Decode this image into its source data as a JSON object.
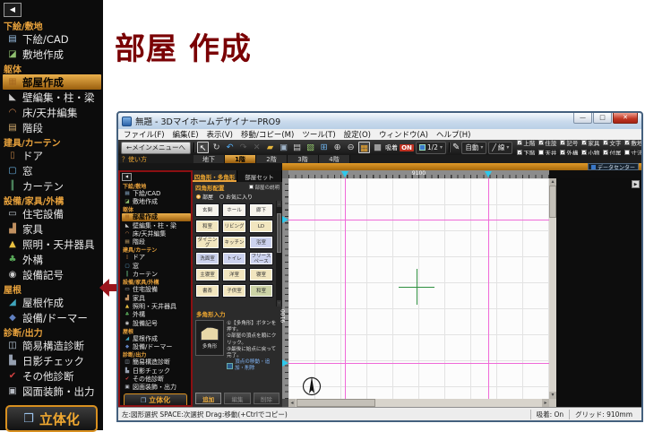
{
  "page": {
    "heading": "部屋 作成"
  },
  "sidebar": {
    "collapse_glyph": "◀",
    "items": [
      {
        "t": "section",
        "label": "下絵/敷地"
      },
      {
        "t": "item",
        "label": "下絵/CAD",
        "glyph": "▤",
        "color": "#9cc2e6"
      },
      {
        "t": "item",
        "label": "敷地作成",
        "glyph": "◪",
        "color": "#8fbf6f"
      },
      {
        "t": "section",
        "label": "躯体"
      },
      {
        "t": "item",
        "label": "部屋作成",
        "glyph": "▦",
        "color": "#a86a20",
        "selected": true
      },
      {
        "t": "item",
        "label": "壁編集・柱・梁",
        "glyph": "◣",
        "color": "#c8c8c8"
      },
      {
        "t": "item",
        "label": "床/天井編集",
        "glyph": "◠",
        "color": "#c8824e"
      },
      {
        "t": "item",
        "label": "階段",
        "glyph": "▤",
        "color": "#d8b070"
      },
      {
        "t": "section",
        "label": "建具/カーテン"
      },
      {
        "t": "item",
        "label": "ドア",
        "glyph": "▯",
        "color": "#b07840"
      },
      {
        "t": "item",
        "label": "窓",
        "glyph": "▢",
        "color": "#6cb4e4"
      },
      {
        "t": "item",
        "label": "カーテン",
        "glyph": "║",
        "color": "#6cc084"
      },
      {
        "t": "section",
        "label": "設備/家具/外構"
      },
      {
        "t": "item",
        "label": "住宅設備",
        "glyph": "▭",
        "color": "#c2cad2"
      },
      {
        "t": "item",
        "label": "家具",
        "glyph": "▟",
        "color": "#c09060"
      },
      {
        "t": "item",
        "label": "照明・天井器具",
        "glyph": "▲",
        "color": "#e8c040"
      },
      {
        "t": "item",
        "label": "外構",
        "glyph": "♣",
        "color": "#58a858"
      },
      {
        "t": "item",
        "label": "設備記号",
        "glyph": "◉",
        "color": "#d0d0d0"
      },
      {
        "t": "section",
        "label": "屋根"
      },
      {
        "t": "item",
        "label": "屋根作成",
        "glyph": "◢",
        "color": "#3fa4bc"
      },
      {
        "t": "item",
        "label": "設備/ドーマー",
        "glyph": "◆",
        "color": "#6080c0"
      },
      {
        "t": "section",
        "label": "診断/出力"
      },
      {
        "t": "item",
        "label": "簡易構造診断",
        "glyph": "◫",
        "color": "#c0d0e0"
      },
      {
        "t": "item",
        "label": "日影チェック",
        "glyph": "▙",
        "color": "#96a0b0"
      },
      {
        "t": "item",
        "label": "その他診断",
        "glyph": "✔",
        "color": "#d04040"
      },
      {
        "t": "item",
        "label": "図面装飾・出力",
        "glyph": "▣",
        "color": "#b8bcc4"
      }
    ],
    "solid_button": {
      "label": "立体化",
      "glyph": "❒"
    }
  },
  "win": {
    "title": "無題 - 3DマイホームデザイナーPRO9",
    "controls": {
      "min": "—",
      "max": "□",
      "close": "✕"
    },
    "menus": [
      "ファイル(F)",
      "編集(E)",
      "表示(V)",
      "移動/コピー(M)",
      "ツール(T)",
      "設定(O)",
      "ウィンドウ(A)",
      "ヘルプ(H)"
    ],
    "toolbar": {
      "back": "←メインメニューへ",
      "icons": [
        {
          "name": "select-cursor-icon",
          "glyph": "↖",
          "color": "#ffffff",
          "active": true
        },
        {
          "name": "rotate-select-icon",
          "glyph": "↻",
          "color": "#cfcfcf"
        },
        {
          "name": "undo-icon",
          "glyph": "↶",
          "color": "#54aaf0"
        },
        {
          "name": "redo-icon",
          "glyph": "↷",
          "color": "#5a5a5a"
        },
        {
          "name": "delete-icon",
          "glyph": "✕",
          "color": "#5a5a5a"
        },
        {
          "name": "open-file-icon",
          "glyph": "▰",
          "color": "#e6b63c"
        },
        {
          "name": "save-icon",
          "glyph": "▣",
          "color": "#9fb3c7"
        },
        {
          "name": "print-icon",
          "glyph": "▤",
          "color": "#c9c9c9"
        },
        {
          "name": "image-icon",
          "glyph": "▧",
          "color": "#8fc06a"
        },
        {
          "name": "fit-view-icon",
          "glyph": "⊞",
          "color": "#6fb4ec"
        },
        {
          "name": "zoom-in-icon",
          "glyph": "⊕",
          "color": "#d6d6d6"
        },
        {
          "name": "zoom-out-icon",
          "glyph": "⊖",
          "color": "#d6d6d6"
        },
        {
          "name": "grid-toggle-icon",
          "glyph": "▦",
          "color": "#f0a830",
          "active": true
        },
        {
          "name": "fill-toggle-icon",
          "glyph": "■",
          "color": "#9a9a9a"
        }
      ],
      "snap": {
        "label": "吸着",
        "state": "ON"
      },
      "scale": {
        "value": "1/2",
        "caret": "▾"
      },
      "pen_glyph": "✎",
      "auto": {
        "label": "自動",
        "caret": "▾"
      },
      "line": {
        "glyph": "╱",
        "label": "線",
        "caret": "▾"
      },
      "checks_row1": [
        {
          "label": "上階",
          "checked": true
        },
        {
          "label": "住設",
          "checked": true
        },
        {
          "label": "記号",
          "checked": true
        },
        {
          "label": "家具",
          "checked": true
        },
        {
          "label": "文字",
          "checked": true
        },
        {
          "label": "敷地",
          "checked": true
        }
      ],
      "checks_row2": [
        {
          "label": "下階",
          "checked": true
        },
        {
          "label": "天井",
          "checked": false
        },
        {
          "label": "外構",
          "checked": true
        },
        {
          "label": "小物",
          "checked": true
        },
        {
          "label": "付属",
          "checked": true
        },
        {
          "label": "寸法線",
          "checked": false
        }
      ]
    },
    "floorbar": {
      "help": "？使い方",
      "tabs": [
        {
          "label": "地下"
        },
        {
          "label": "1階",
          "selected": true
        },
        {
          "label": "2階"
        },
        {
          "label": "3階"
        },
        {
          "label": "4階"
        }
      ]
    },
    "datacenter": {
      "label": "データセンター"
    },
    "panel": {
      "tabs": [
        {
          "label": "四角形・多角形",
          "selected": true
        },
        {
          "label": "部屋セット"
        }
      ],
      "section": "四角形配置",
      "desc_check": "部屋の説明",
      "radios": [
        {
          "label": "部屋",
          "selected": true
        },
        {
          "label": "お気に入り"
        }
      ],
      "rooms": [
        {
          "label": "玄関",
          "bg": "#f7f4ec"
        },
        {
          "label": "ホール",
          "bg": "#f7f4ec"
        },
        {
          "label": "廊下",
          "bg": "#f7f4ec"
        },
        {
          "label": "和室",
          "bg": "#f2e6bf"
        },
        {
          "label": "リビング",
          "bg": "#f2e6bf"
        },
        {
          "label": "LD",
          "bg": "#f2e6bf"
        },
        {
          "label": "ダイニング",
          "bg": "#f2e6bf"
        },
        {
          "label": "キッチン",
          "bg": "#f2e6bf"
        },
        {
          "label": "浴室",
          "bg": "#ccd2ee"
        },
        {
          "label": "洗面室",
          "bg": "#ccd2ee"
        },
        {
          "label": "トイレ",
          "bg": "#ccd2ee"
        },
        {
          "label": "フリースペース",
          "bg": "#ccd2ee"
        },
        {
          "label": "主寝室",
          "bg": "#f2e6bf"
        },
        {
          "label": "洋室",
          "bg": "#f2e6bf"
        },
        {
          "label": "寝室",
          "bg": "#f2e6bf"
        },
        {
          "label": "書斎",
          "bg": "#f2e6bf"
        },
        {
          "label": "子供室",
          "bg": "#f2e6bf"
        },
        {
          "label": "和室",
          "bg": "#ccd3a6"
        }
      ],
      "poly_section": "多角形入力",
      "poly_button": "多角形",
      "steps": [
        "①【多角形】ボタンを押す。",
        "②部屋の頂点を順にクリック。",
        "③最後に始点に戻って完了。"
      ],
      "hint": "頂点の移動・追加・削除",
      "actions": [
        {
          "label": "追加",
          "enabled": true
        },
        {
          "label": "編集"
        },
        {
          "label": "削除"
        }
      ]
    },
    "canvas": {
      "hruler_label": "9100",
      "vruler_label": "9100",
      "expand_glyph": "▶"
    },
    "status": {
      "left": "左:図形選択 SPACE:次選択 Drag:移動(+Ctrlでコピー)",
      "snap": "吸着: On",
      "grid": "グリッド: 910mm"
    }
  }
}
